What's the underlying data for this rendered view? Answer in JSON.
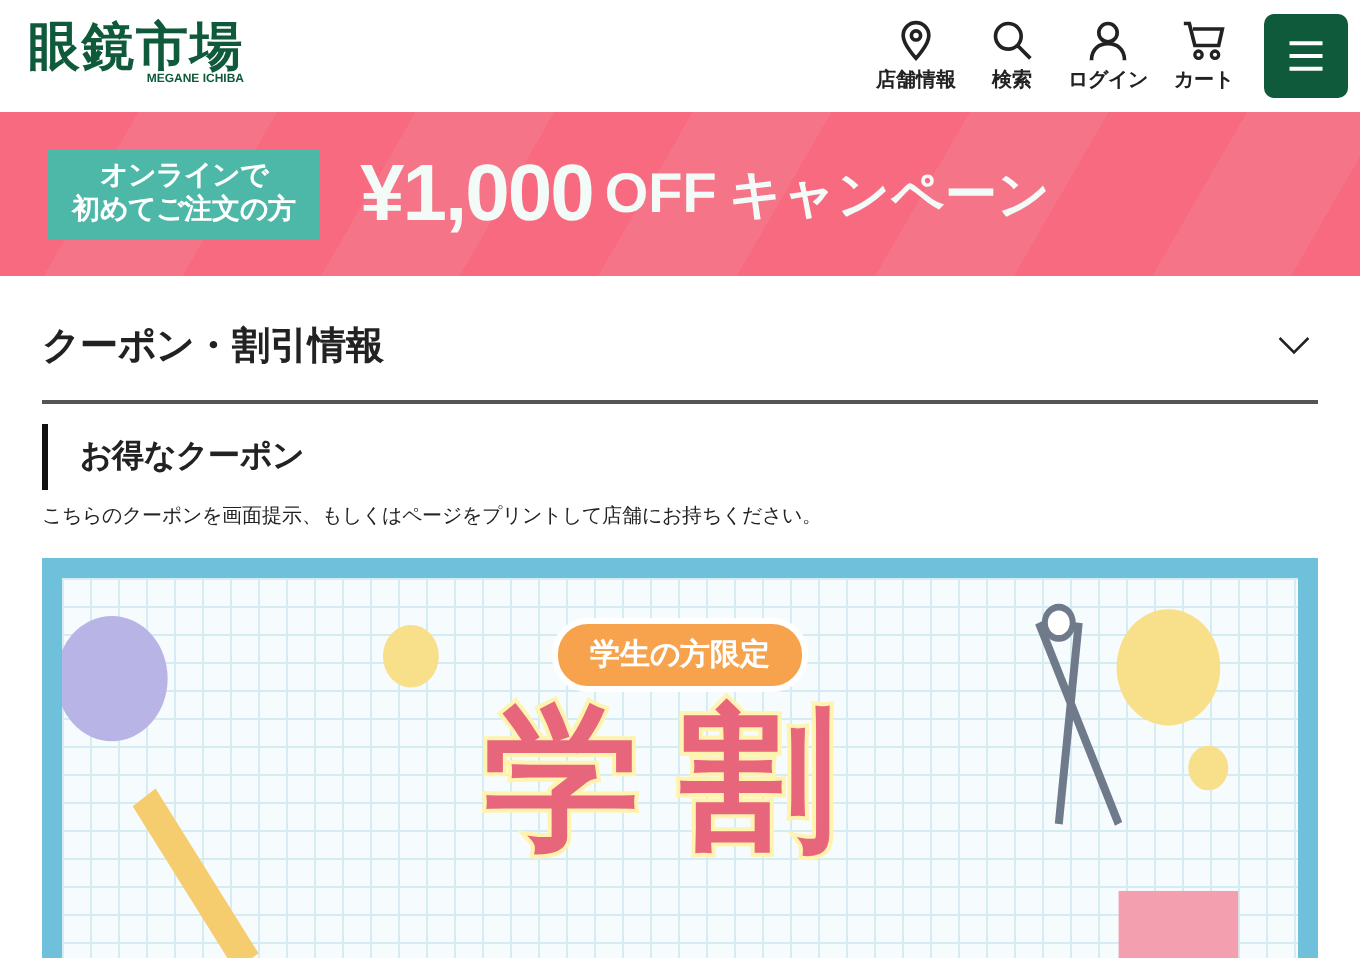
{
  "logo": {
    "title": "眼鏡市場",
    "subtitle": "MEGANE ICHIBA"
  },
  "nav": [
    {
      "kind": "pin",
      "label": "店舗情報"
    },
    {
      "kind": "search",
      "label": "検索"
    },
    {
      "kind": "user",
      "label": "ログイン"
    },
    {
      "kind": "cart",
      "label": "カート"
    }
  ],
  "campaign_banner": {
    "badge_lines": [
      "オンラインで",
      "初めてご注文の方"
    ],
    "amount": "¥1,000",
    "off": "OFF",
    "campaign": "キャンペーン"
  },
  "section": {
    "title": "クーポン・割引情報",
    "expanded": true
  },
  "subsection": {
    "title": "お得なクーポン",
    "note": "こちらのクーポンを画面提示、もしくはページをプリントして店舗にお持ちください。"
  },
  "student_banner": {
    "pill": "学生の方限定",
    "headline": "学割"
  }
}
